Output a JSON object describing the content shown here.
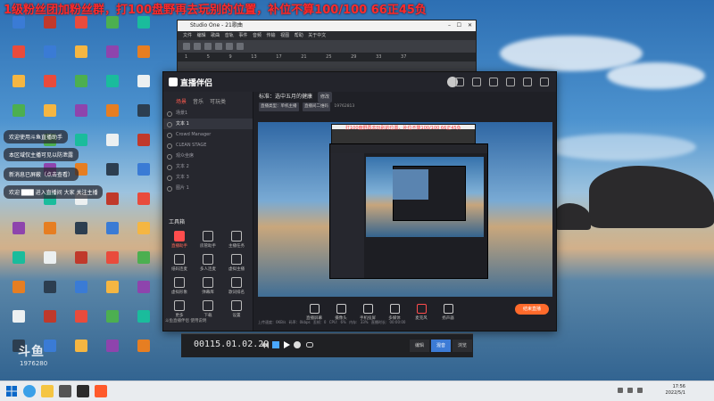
{
  "marquee": "1级粉丝团加粉丝群，打100盘野再去玩别的位置，补位不算100/100 66正45负",
  "chat": [
    "欢迎使用斗鱼直播助手",
    "本区域仅主播可见以防泄露",
    "新消息已屏蔽（点击查看）",
    "欢迎 ███ 进入直播间 大家 关注主播"
  ],
  "studio": {
    "title": "Studio One - 21歌曲",
    "menu": "文件 编辑 歌曲 音轨 事件 音频 传输 视图 帮助 关于中文",
    "ruler": "1 5 9 13 17 21 25 29 33 37",
    "time": "00115.01.02.29",
    "tabs": [
      "编辑",
      "混音",
      "浏览"
    ]
  },
  "live": {
    "app_name": "直播伴侣",
    "left_tabs": [
      "场景",
      "音乐",
      "可玩类"
    ],
    "scenes": [
      "场景1",
      "文本 1",
      "Crowd Manager",
      "CLEAN STAGE",
      "观众坐席",
      "文本 2",
      "文本 3",
      "图片 1"
    ],
    "tools_header": "工具箱",
    "tools": [
      {
        "label": "直播助手"
      },
      {
        "label": "房管助手"
      },
      {
        "label": "主播任务"
      },
      {
        "label": "纸码连麦"
      },
      {
        "label": "多人连麦"
      },
      {
        "label": "虚拟主播"
      },
      {
        "label": "虚拟形象"
      },
      {
        "label": "弹幕库"
      },
      {
        "label": "歌词排名"
      },
      {
        "label": "更多"
      },
      {
        "label": "下载"
      },
      {
        "label": "设置"
      }
    ],
    "notice": "斗鱼直播伴侣 使用说明",
    "room": "标准：选中五月的健康",
    "room_tag": "修改",
    "room_sub": [
      "直播类型：单机主播",
      "直播间二维码",
      "19762813"
    ],
    "overlay_text": "打100盘野再去玩别的位置，补位不算100/100 66正45负",
    "controls": [
      "直播屏幕",
      "摄像头",
      "手机投屏",
      "多媒体",
      "麦克风",
      "扬声器"
    ],
    "go_live": "结束直播",
    "stats": "上传速度：0KB/s  码率：0kbps  丢帧：0  CPU: 6%  内存: 33%  直播时长: 00:00:00"
  },
  "watermark": {
    "brand": "斗鱼",
    "room": "1976280"
  },
  "clock": {
    "time": "17:56",
    "date": "2022/5/1"
  }
}
